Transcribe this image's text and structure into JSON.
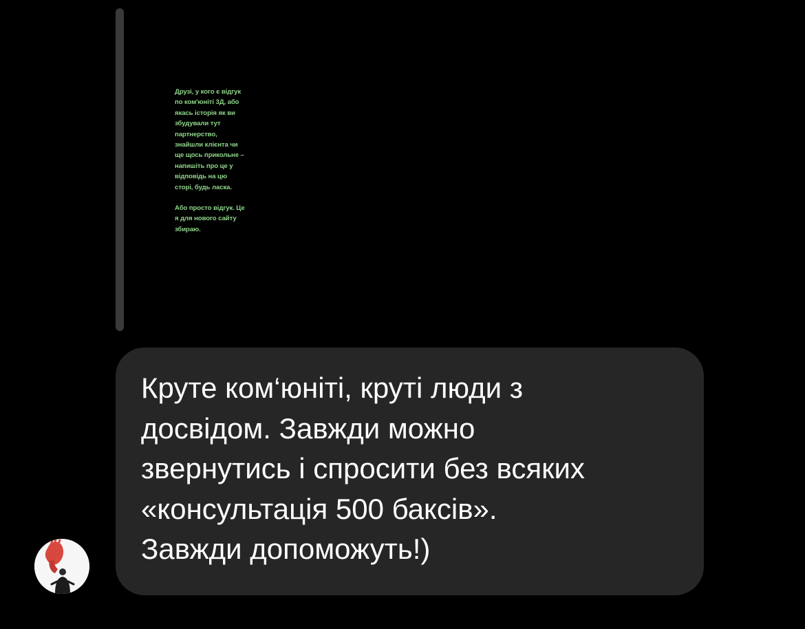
{
  "story_reply": {
    "paragraphs": [
      "Друзі, у кого є відгук\nпо ком'юніті 3Д, або\nякась історія як ви\nзбудували тут\nпартнерство,\nзнайшли клієнта чи\nще щось прикольне –\nнапишіть про це у\nвідповідь на цю\nсторі, будь ласка.",
      "Або просто відгук. Це\nя для нового сайту\nзбираю."
    ],
    "text_color": "#8fd48a"
  },
  "message": {
    "text": "Круте ком‘юніті, круті люди з\nдосвідом. Завжди можно\nзвернутись і спросити без всяких\n«консультація 500 баксів».\nЗавжди допоможуть!)",
    "bubble_color": "#262626",
    "text_color": "#ffffff"
  },
  "sender": {
    "avatar_icon": "user-avatar-photo"
  },
  "colors": {
    "background": "#000000",
    "reply_bar": "#3a3a3c"
  }
}
